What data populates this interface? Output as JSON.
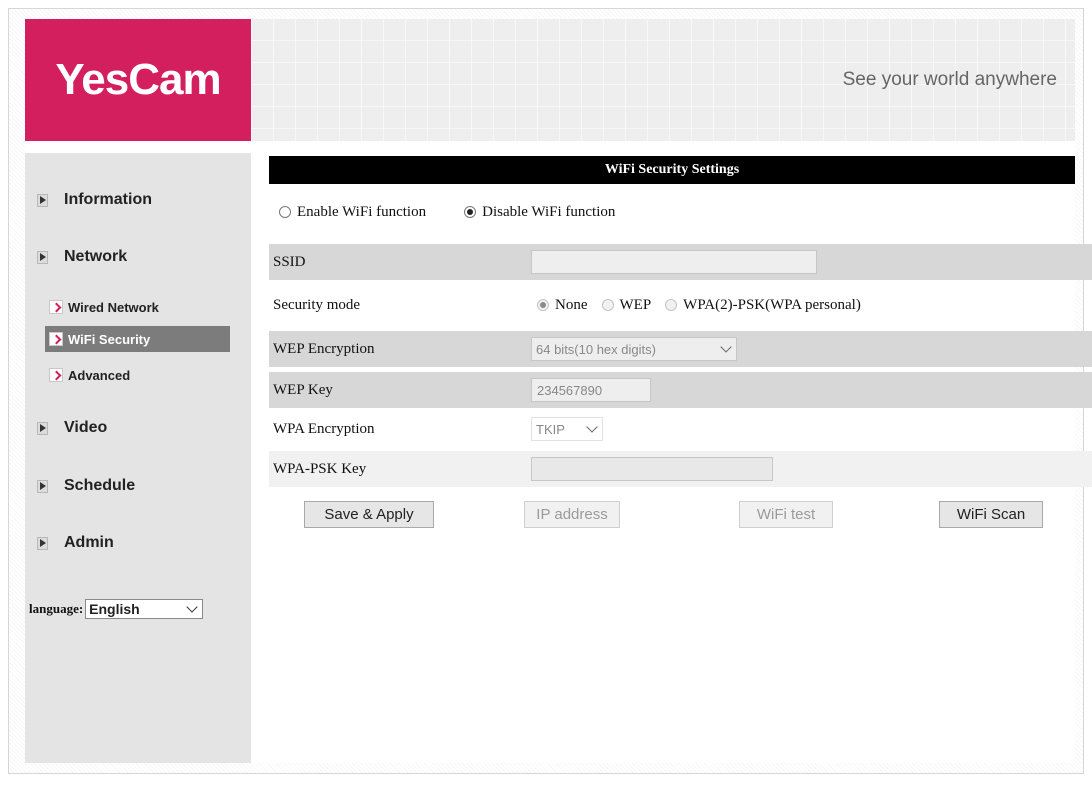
{
  "header": {
    "logo": "YesCam",
    "tagline": "See your world anywhere"
  },
  "sidebar": {
    "menu": [
      {
        "label": "Information"
      },
      {
        "label": "Network"
      },
      {
        "label": "Video"
      },
      {
        "label": "Schedule"
      },
      {
        "label": "Admin"
      }
    ],
    "network_sub": [
      {
        "label": "Wired Network",
        "active": false
      },
      {
        "label": "WiFi Security",
        "active": true
      },
      {
        "label": "Advanced",
        "active": false
      }
    ],
    "language_label": "language:",
    "language_value": "English"
  },
  "main": {
    "title": "WiFi Security Settings",
    "wifi_toggle": {
      "enable_label": "Enable WiFi function",
      "disable_label": "Disable WiFi function",
      "selected": "disable"
    },
    "fields": {
      "ssid_label": "SSID",
      "ssid_value": "",
      "security_mode_label": "Security mode",
      "security_mode_options": [
        "None",
        "WEP",
        "WPA(2)-PSK(WPA personal)"
      ],
      "security_mode_selected": "None",
      "wep_encryption_label": "WEP Encryption",
      "wep_encryption_value": "64 bits(10 hex digits)",
      "wep_key_label": "WEP Key",
      "wep_key_value": "234567890",
      "wpa_encryption_label": "WPA Encryption",
      "wpa_encryption_value": "TKIP",
      "wpa_psk_key_label": "WPA-PSK Key",
      "wpa_psk_key_value": ""
    },
    "buttons": {
      "save_apply": "Save & Apply",
      "ip_address": "IP address",
      "wifi_test": "WiFi test",
      "wifi_scan": "WiFi Scan"
    }
  },
  "colors": {
    "brand": "#d41f5e",
    "title_bar": "#000000",
    "active_item": "#7c7c7c"
  }
}
